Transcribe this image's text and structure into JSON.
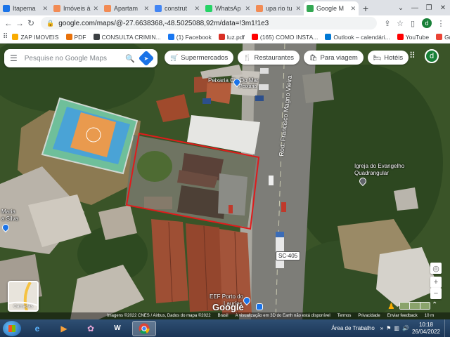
{
  "tabs": [
    {
      "title": "Itapema",
      "color": "#1a73e8",
      "active": false
    },
    {
      "title": "Imóveis à",
      "color": "#f28b54",
      "active": false
    },
    {
      "title": "Apartam",
      "color": "#f28b54",
      "active": false
    },
    {
      "title": "construt",
      "color": "#4285f4",
      "active": false
    },
    {
      "title": "WhatsAp",
      "color": "#25d366",
      "active": false
    },
    {
      "title": "upa rio tu",
      "color": "#f28b54",
      "active": false
    },
    {
      "title": "Google M",
      "color": "#34a853",
      "active": true
    }
  ],
  "browser": {
    "url": "google.com/maps/@-27.6638368,-48.5025088,92m/data=!3m1!1e3",
    "profile_initial": "d"
  },
  "bookmarks": [
    {
      "label": "ZAP IMOVEIS",
      "color": "#f9ab00"
    },
    {
      "label": "PDF",
      "color": "#e8710a"
    },
    {
      "label": "CONSULTA CRIMIN...",
      "color": "#3c4043"
    },
    {
      "label": "(1) Facebook",
      "color": "#1877f2"
    },
    {
      "label": "luz.pdf",
      "color": "#d93025"
    },
    {
      "label": "(165) COMO INSTA...",
      "color": "#ff0000"
    },
    {
      "label": "Outlook – calendári...",
      "color": "#0078d4"
    },
    {
      "label": "YouTube",
      "color": "#ff0000"
    },
    {
      "label": "Gmail",
      "color": "#ea4335"
    }
  ],
  "maps": {
    "search_placeholder": "Pesquise no Google Maps",
    "chips": [
      {
        "label": "Supermercados",
        "icon": "cart-icon",
        "glyph": "🛒"
      },
      {
        "label": "Restaurantes",
        "icon": "fork-knife-icon",
        "glyph": "🍴"
      },
      {
        "label": "Para viagem",
        "icon": "bag-icon",
        "glyph": "🛍"
      },
      {
        "label": "Hotéis",
        "icon": "bed-icon",
        "glyph": "🛏"
      }
    ],
    "avatar_initial": "d",
    "labels": {
      "peixaria": "Peixaria Cia Do Mar",
      "peixaria_sub": "Peixaria",
      "road": "Rod. Francisco Magno Vieira",
      "church_line1": "Igreja do Evangelho",
      "church_line2": "Quadrangular",
      "maria_line1": "Maria",
      "maria_line2": "a Silva",
      "eef_line1": "EEF Porto do",
      "eef_line2": "Lauríes",
      "highway": "SC-405"
    },
    "layers_label": "Camadas",
    "logo": "Google",
    "status": {
      "imagery": "Imagens ©2022 CNES / Airbus, Dados do mapa ©2022",
      "country": "Brasil",
      "notice": "A visualização em 3D do Earth não está disponível",
      "terms": "Termos",
      "privacy": "Privacidade",
      "feedback": "Enviar feedback",
      "scale": "10 m"
    }
  },
  "taskbar": {
    "desktop_label": "Área de Trabalho",
    "time": "10:18",
    "date": "26/04/2022"
  }
}
